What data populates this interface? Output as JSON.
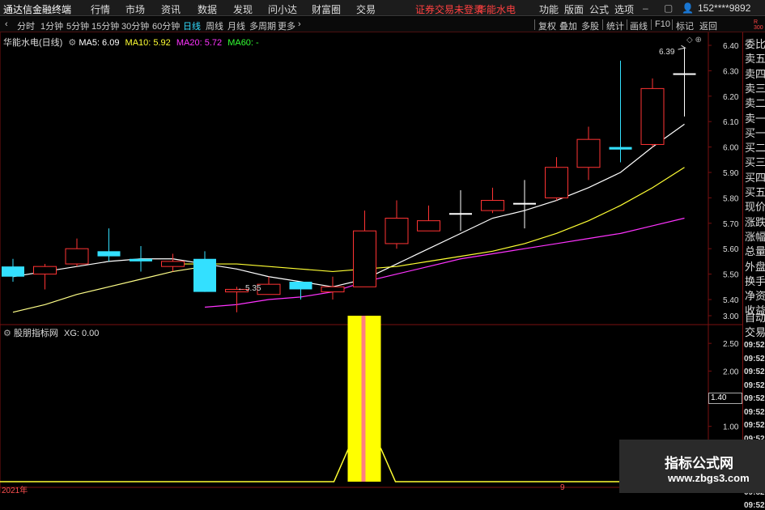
{
  "menubar": {
    "app_title": "通达信金融终端",
    "items": [
      "行情",
      "市场",
      "资讯",
      "数据",
      "发现",
      "问小达",
      "财富圈",
      "交易"
    ],
    "notice": "证券交易未登录",
    "stock_name": "华能水电",
    "right_items": [
      "功能",
      "版面",
      "公式",
      "选项"
    ],
    "user": "152****9892"
  },
  "tabbar": {
    "periods": [
      "分时",
      "1分钟",
      "5分钟",
      "15分钟",
      "30分钟",
      "60分钟",
      "日线",
      "周线",
      "月线",
      "多周期",
      "更多"
    ],
    "active": "日线",
    "right_tools": [
      "复权",
      "叠加",
      "多股",
      "统计",
      "画线",
      "F10",
      "标记",
      "返回"
    ]
  },
  "main_chart": {
    "title": "华能水电(日线)",
    "ma": [
      {
        "label": "MA5: 6.09",
        "color": "#ffffff"
      },
      {
        "label": "MA10: 5.92",
        "color": "#ffff33"
      },
      {
        "label": "MA20: 5.72",
        "color": "#ff33ff"
      },
      {
        "label": "MA60: -",
        "color": "#33ff33"
      }
    ],
    "high_label": "6.39",
    "low_label": "5.35",
    "y_ticks": [
      "6.40",
      "6.30",
      "6.20",
      "6.10",
      "6.00",
      "5.90",
      "5.80",
      "5.70",
      "5.60",
      "5.50",
      "5.40"
    ]
  },
  "sub_chart": {
    "title": "股朋指标网",
    "value_label": "XG: 0.00",
    "y_ticks": [
      "3.00",
      "2.50",
      "2.00",
      "1.50",
      "1.00",
      "0.50"
    ],
    "price_box": "1.40"
  },
  "x_axis": {
    "start": "2021年",
    "mid": "9"
  },
  "right_panel": {
    "top_tag": "R\n300",
    "labels": [
      "委比",
      "卖五",
      "卖四",
      "卖三",
      "卖二",
      "卖一",
      "买一",
      "买二",
      "买三",
      "买四",
      "买五",
      "现价",
      "涨跌",
      "涨幅",
      "总量",
      "外盘",
      "换手",
      "净资",
      "收益"
    ],
    "labels2": [
      "自动",
      "交易"
    ],
    "times": [
      "09:52",
      "09:52",
      "09:52",
      "09:52",
      "09:52",
      "09:52",
      "09:52",
      "09:52",
      "09:52",
      "09:52",
      "09:52",
      "09:52",
      "09:52"
    ]
  },
  "watermark": {
    "title": "指标公式网",
    "url": "www.zbgs3.com"
  },
  "chart_data": {
    "type": "candlestick",
    "candles": [
      {
        "o": 5.53,
        "c": 5.49,
        "h": 5.56,
        "l": 5.47
      },
      {
        "o": 5.5,
        "c": 5.53,
        "h": 5.54,
        "l": 5.44
      },
      {
        "o": 5.54,
        "c": 5.6,
        "h": 5.64,
        "l": 5.53
      },
      {
        "o": 5.59,
        "c": 5.57,
        "h": 5.68,
        "l": 5.55
      },
      {
        "o": 5.56,
        "c": 5.55,
        "h": 5.61,
        "l": 5.51
      },
      {
        "o": 5.53,
        "c": 5.55,
        "h": 5.58,
        "l": 5.51
      },
      {
        "o": 5.56,
        "c": 5.43,
        "h": 5.59,
        "l": 5.43
      },
      {
        "o": 5.43,
        "c": 5.44,
        "h": 5.45,
        "l": 5.35
      },
      {
        "o": 5.42,
        "c": 5.46,
        "h": 5.49,
        "l": 5.42
      },
      {
        "o": 5.47,
        "c": 5.44,
        "h": 5.47,
        "l": 5.4
      },
      {
        "o": 5.43,
        "c": 5.45,
        "h": 5.49,
        "l": 5.4
      },
      {
        "o": 5.45,
        "c": 5.67,
        "h": 5.75,
        "l": 5.45
      },
      {
        "o": 5.62,
        "c": 5.72,
        "h": 5.79,
        "l": 5.6
      },
      {
        "o": 5.67,
        "c": 5.71,
        "h": 5.77,
        "l": 5.67
      },
      {
        "o": 5.74,
        "c": 5.74,
        "h": 5.83,
        "l": 5.67
      },
      {
        "o": 5.75,
        "c": 5.79,
        "h": 5.84,
        "l": 5.74
      },
      {
        "o": 5.78,
        "c": 5.78,
        "h": 5.87,
        "l": 5.68
      },
      {
        "o": 5.8,
        "c": 5.92,
        "h": 5.96,
        "l": 5.79
      },
      {
        "o": 5.92,
        "c": 6.03,
        "h": 6.08,
        "l": 5.87
      },
      {
        "o": 6.0,
        "c": 5.99,
        "h": 6.34,
        "l": 5.94
      },
      {
        "o": 6.01,
        "c": 6.23,
        "h": 6.27,
        "l": 6.0
      },
      {
        "o": 6.29,
        "c": 6.29,
        "h": 6.39,
        "l": 6.12
      }
    ],
    "ma5": [
      5.49,
      5.51,
      5.53,
      5.55,
      5.56,
      5.56,
      5.54,
      5.52,
      5.49,
      5.47,
      5.45,
      5.48,
      5.54,
      5.6,
      5.66,
      5.72,
      5.75,
      5.79,
      5.84,
      5.9,
      6.0,
      6.09
    ],
    "ma10": [
      null,
      null,
      null,
      null,
      null,
      5.54,
      5.54,
      5.54,
      5.53,
      5.52,
      5.51,
      5.52,
      5.53,
      5.55,
      5.57,
      5.59,
      5.62,
      5.66,
      5.71,
      5.77,
      5.84,
      5.92
    ],
    "ma20": [
      null,
      null,
      null,
      null,
      null,
      null,
      5.37,
      5.38,
      5.4,
      5.41,
      5.43,
      5.47,
      5.5,
      5.53,
      5.56,
      5.58,
      5.6,
      5.62,
      5.64,
      5.66,
      5.69,
      5.72
    ],
    "ma_line0": [
      5.35,
      5.38,
      5.42,
      5.45,
      5.48,
      5.51,
      5.53
    ],
    "signal_index": 11,
    "signal_value": 3.0,
    "price_range": [
      5.35,
      6.45
    ],
    "sub_range": [
      0,
      3.2
    ]
  }
}
